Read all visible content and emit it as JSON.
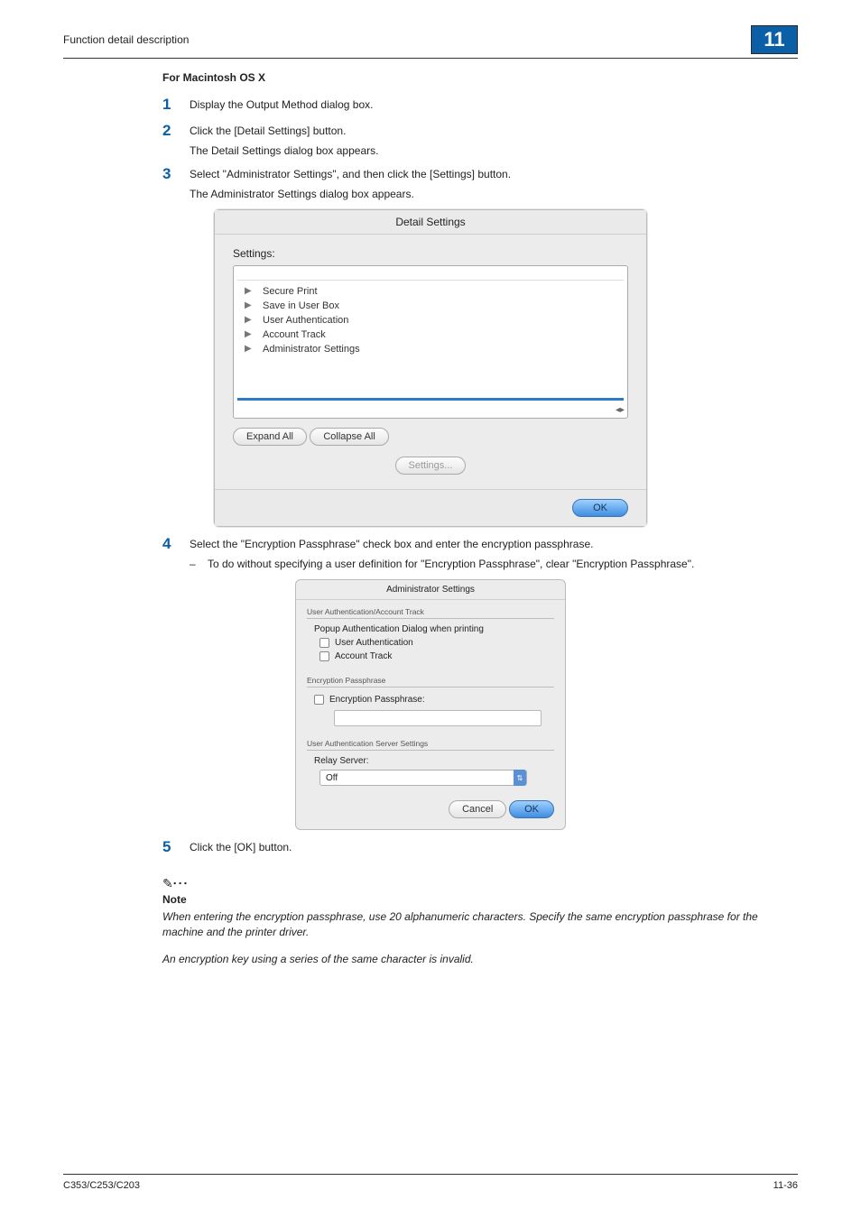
{
  "header": {
    "breadcrumb": "Function detail description",
    "chapter": "11"
  },
  "section_title": "For Macintosh OS X",
  "steps": {
    "s1": {
      "num": "1",
      "text": "Display the Output Method dialog box."
    },
    "s2": {
      "num": "2",
      "text": "Click the [Detail Settings] button.",
      "sub": "The Detail Settings dialog box appears."
    },
    "s3": {
      "num": "3",
      "text": "Select \"Administrator Settings\", and then click the [Settings] button.",
      "sub": "The Administrator Settings dialog box appears."
    },
    "s4": {
      "num": "4",
      "text": "Select the \"Encryption Passphrase\" check box and enter the encryption passphrase.",
      "dash": "To do without specifying a user definition for \"Encryption Passphrase\", clear \"Encryption Passphrase\"."
    },
    "s5": {
      "num": "5",
      "text": "Click the [OK] button."
    }
  },
  "dialog1": {
    "title": "Detail Settings",
    "label": "Settings:",
    "items": [
      "Secure Print",
      "Save in User Box",
      "User Authentication",
      "Account Track",
      "Administrator Settings"
    ],
    "expand": "Expand All",
    "collapse": "Collapse All",
    "settings_btn": "Settings...",
    "ok": "OK"
  },
  "dialog2": {
    "title": "Administrator Settings",
    "group1": {
      "legend": "User Authentication/Account Track",
      "heading": "Popup Authentication Dialog when printing",
      "cb1": "User Authentication",
      "cb2": "Account Track"
    },
    "group2": {
      "legend": "Encryption Passphrase",
      "cb": "Encryption Passphrase:"
    },
    "group3": {
      "legend": "User Authentication Server Settings",
      "label": "Relay Server:",
      "value": "Off"
    },
    "cancel": "Cancel",
    "ok": "OK"
  },
  "note": {
    "label": "Note",
    "p1": "When entering the encryption passphrase, use 20 alphanumeric characters. Specify the same encryption passphrase for the machine and the printer driver.",
    "p2": "An encryption key using a series of the same character is invalid."
  },
  "footer": {
    "left": "C353/C253/C203",
    "right": "11-36"
  }
}
